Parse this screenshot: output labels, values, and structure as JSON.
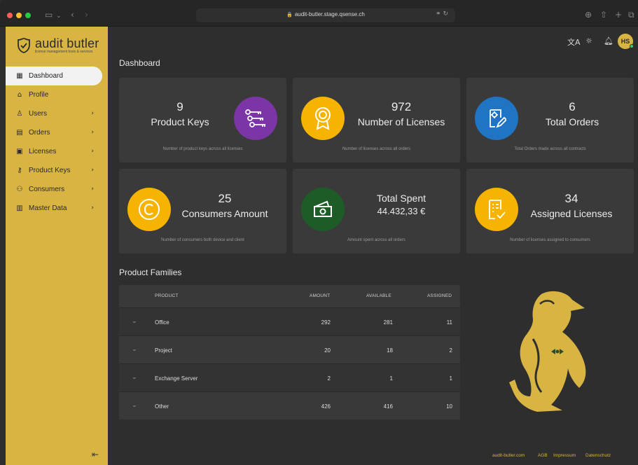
{
  "browser": {
    "url": "audit-butler.stage.qsense.ch"
  },
  "sidebar": {
    "logo_name": "audit butler",
    "logo_tagline": "license management tools & services",
    "items": [
      {
        "label": "Dashboard",
        "icon": "grid-icon",
        "active": true,
        "has_children": false
      },
      {
        "label": "Profile",
        "icon": "home-icon",
        "active": false,
        "has_children": false
      },
      {
        "label": "Users",
        "icon": "user-icon",
        "active": false,
        "has_children": true
      },
      {
        "label": "Orders",
        "icon": "document-icon",
        "active": false,
        "has_children": true
      },
      {
        "label": "Licenses",
        "icon": "license-icon",
        "active": false,
        "has_children": true
      },
      {
        "label": "Product Keys",
        "icon": "key-icon",
        "active": false,
        "has_children": true
      },
      {
        "label": "Consumers",
        "icon": "consumers-icon",
        "active": false,
        "has_children": true
      },
      {
        "label": "Master Data",
        "icon": "table-icon",
        "active": false,
        "has_children": true
      }
    ]
  },
  "header": {
    "user_initials": "HS"
  },
  "page_title": "Dashboard",
  "cards": [
    {
      "value": "9",
      "label": "Product Keys",
      "description": "Number of product keys across all licenses",
      "icon": "keys-icon",
      "color": "#7b35a6"
    },
    {
      "value": "972",
      "label": "Number of Licenses",
      "description": "Number of licenses across all orders",
      "icon": "award-icon",
      "color": "#f6b400"
    },
    {
      "value": "6",
      "label": "Total Orders",
      "description": "Total Orders made across all contracts",
      "icon": "order-edit-icon",
      "color": "#1f74c4"
    },
    {
      "value": "25",
      "label": "Consumers Amount",
      "description": "Number of consumers both device and client",
      "icon": "copyright-icon",
      "color": "#f6b400"
    },
    {
      "value": "Total Spent",
      "label": "44.432,33 €",
      "description": "Amount spent across all orders",
      "icon": "money-icon",
      "color": "#1d5c27"
    },
    {
      "value": "34",
      "label": "Assigned Licenses",
      "description": "Number of licenses assigned to consumers",
      "icon": "assigned-doc-icon",
      "color": "#f6b400"
    }
  ],
  "product_families": {
    "title": "Product Families",
    "columns": [
      "PRODUCT",
      "AMOUNT",
      "AVAILABLE",
      "ASSIGNED"
    ],
    "rows": [
      {
        "product": "Office",
        "amount": "292",
        "available": "281",
        "assigned": "11"
      },
      {
        "product": "Project",
        "amount": "20",
        "available": "18",
        "assigned": "2"
      },
      {
        "product": "Exchange Server",
        "amount": "2",
        "available": "1",
        "assigned": "1"
      },
      {
        "product": "Other",
        "amount": "426",
        "available": "416",
        "assigned": "10"
      }
    ]
  },
  "footer": {
    "links": [
      "audit-butler.com",
      "AGB",
      "Impressum",
      "Datenschutz"
    ]
  },
  "colors": {
    "brand": "#d8b443",
    "background": "#2e2e2e",
    "card": "#3a3a3a"
  }
}
